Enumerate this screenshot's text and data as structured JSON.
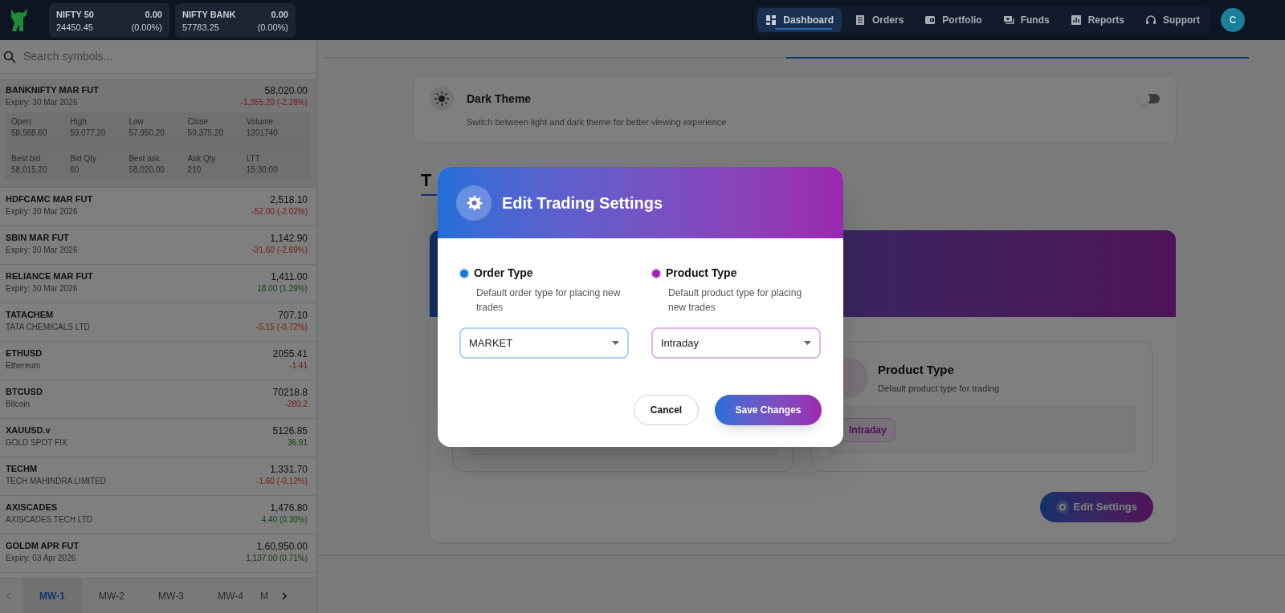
{
  "topbar": {
    "indices": [
      {
        "name": "NIFTY 50",
        "change": "0.00",
        "value": "24450.45",
        "percent": "(0.00%)"
      },
      {
        "name": "NIFTY BANK",
        "change": "0.00",
        "value": "57783.25",
        "percent": "(0.00%)"
      }
    ],
    "nav": [
      {
        "label": "Dashboard",
        "selected": true
      },
      {
        "label": "Orders",
        "selected": false
      },
      {
        "label": "Portfolio",
        "selected": false
      },
      {
        "label": "Funds",
        "selected": false
      },
      {
        "label": "Reports",
        "selected": false
      },
      {
        "label": "Support",
        "selected": false
      }
    ],
    "avatar": "C"
  },
  "sidebar": {
    "search": {
      "placeholder": "Search symbols..."
    },
    "items": [
      {
        "symbol": "BANKNIFTY MAR FUT",
        "subtitle": "Expiry: 30 Mar 2026",
        "price": "58,020.00",
        "change": "-1,355.20 (-2.28%)",
        "kind": "loss",
        "expanded": true,
        "details": [
          {
            "label": "Open",
            "value": "58,988.60"
          },
          {
            "label": "High",
            "value": "59,077.20"
          },
          {
            "label": "Low",
            "value": "57,950.20"
          },
          {
            "label": "Close",
            "value": "59,375.20"
          },
          {
            "label": "Volume",
            "value": "1201740"
          },
          {
            "label": "Best bid",
            "value": "58,015.20"
          },
          {
            "label": "Bid Qty",
            "value": "60"
          },
          {
            "label": "Best ask",
            "value": "58,020.00"
          },
          {
            "label": "Ask Qty",
            "value": "210"
          },
          {
            "label": "LTT",
            "value": "15:30:00"
          }
        ]
      },
      {
        "symbol": "HDFCAMC MAR FUT",
        "subtitle": "Expiry: 30 Mar 2026",
        "price": "2,518.10",
        "change": "-52.00 (-2.02%)",
        "kind": "loss",
        "expanded": false
      },
      {
        "symbol": "SBIN MAR FUT",
        "subtitle": "Expiry: 30 Mar 2026",
        "price": "1,142.90",
        "change": "-31.60 (-2.69%)",
        "kind": "loss",
        "expanded": false
      },
      {
        "symbol": "RELIANCE MAR FUT",
        "subtitle": "Expiry: 30 Mar 2026",
        "price": "1,411.00",
        "change": "18.00 (1.29%)",
        "kind": "gain",
        "expanded": false
      },
      {
        "symbol": "TATACHEM",
        "subtitle": "TATA CHEMICALS LTD",
        "price": "707.10",
        "change": "-5.15 (-0.72%)",
        "kind": "loss",
        "expanded": false
      },
      {
        "symbol": "ETHUSD",
        "subtitle": "Ethereum",
        "price": "2055.41",
        "change": "-1.41",
        "kind": "loss",
        "expanded": false
      },
      {
        "symbol": "BTCUSD",
        "subtitle": "Bitcoin",
        "price": "70218.8",
        "change": "-280.2",
        "kind": "loss",
        "expanded": false
      },
      {
        "symbol": "XAUUSD.v",
        "subtitle": "GOLD SPOT FIX",
        "price": "5126.85",
        "change": "36.91",
        "kind": "gain",
        "expanded": false
      },
      {
        "symbol": "TECHM",
        "subtitle": "TECH MAHINDRA LIMITED",
        "price": "1,331.70",
        "change": "-1.60 (-0.12%)",
        "kind": "loss",
        "expanded": false
      },
      {
        "symbol": "AXISCADES",
        "subtitle": "AXISCADES TECH LTD",
        "price": "1,476.80",
        "change": "4.40 (0.30%)",
        "kind": "gain",
        "expanded": false
      },
      {
        "symbol": "GOLDM APR FUT",
        "subtitle": "Expiry: 03 Apr 2026",
        "price": "1,60,950.00",
        "change": "1,137.00 (0.71%)",
        "kind": "gain",
        "expanded": false
      }
    ],
    "watchlist_tabs": [
      {
        "label": "MW-1",
        "selected": true
      },
      {
        "label": "MW-2",
        "selected": false
      },
      {
        "label": "MW-3",
        "selected": false
      },
      {
        "label": "MW-4",
        "selected": false
      },
      {
        "label": "M",
        "selected": false
      }
    ]
  },
  "main": {
    "theme_setting": {
      "title": "Dark Theme",
      "description": "Switch between light and dark theme for better viewing experience",
      "on": false
    },
    "section_heading": "T",
    "product_card": {
      "title": "Product Type",
      "description": "Default product type for trading",
      "value": "Intraday"
    },
    "edit_button": "Edit Settings"
  },
  "modal": {
    "title": "Edit Trading Settings",
    "fields": [
      {
        "label": "Order Type",
        "description": "Default order type for placing new trades",
        "value": "MARKET",
        "color": "#1976d2"
      },
      {
        "label": "Product Type",
        "description": "Default product type for placing new trades",
        "value": "Intraday",
        "color": "#9c27b0"
      }
    ],
    "buttons": [
      {
        "label": "Cancel",
        "kind": "secondary"
      },
      {
        "label": "Save Changes",
        "kind": "primary"
      }
    ]
  }
}
